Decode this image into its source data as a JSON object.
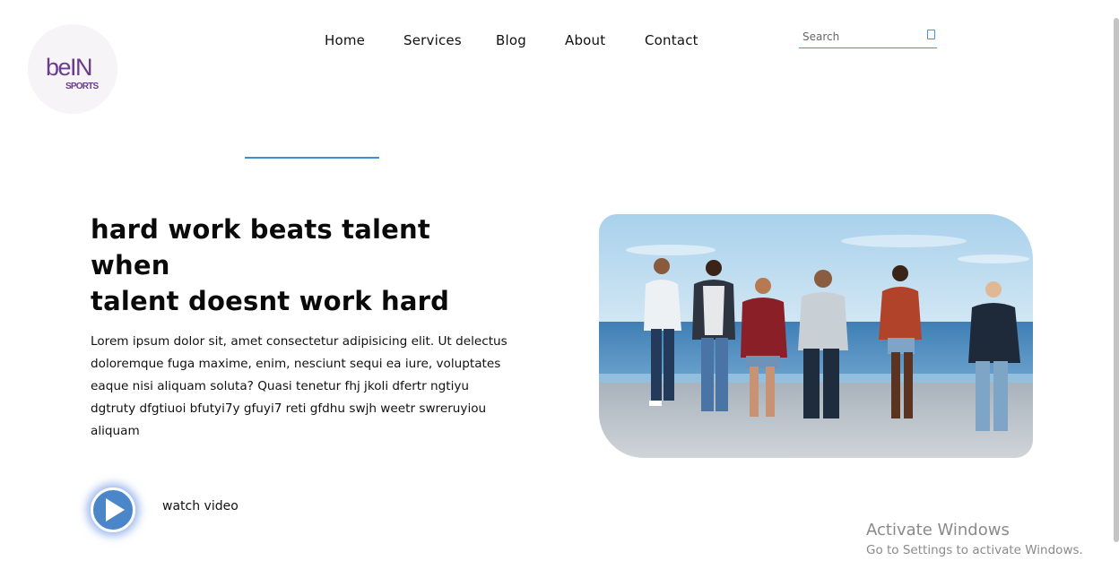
{
  "brand": {
    "logo_text_top": "beIN",
    "logo_text_bottom": "SPORTS",
    "logo_color": "#6b3b8e"
  },
  "nav": {
    "items": [
      {
        "label": "Home"
      },
      {
        "label": "Services"
      },
      {
        "label": "Blog"
      },
      {
        "label": "About"
      },
      {
        "label": "Contact"
      }
    ]
  },
  "search": {
    "placeholder": "Search",
    "value": "",
    "icon": "search-icon"
  },
  "hero": {
    "headline_line1": "hard work beats talent when",
    "headline_line2": "talent doesnt work hard",
    "body": "Lorem ipsum dolor sit, amet consectetur adipisicing elit. Ut delectus doloremque fuga maxime, enim, nesciunt sequi ea iure, voluptates eaque nisi aliquam soluta? Quasi tenetur fhj jkoli dfertr ngtiyu dgtruty dfgtiuoi bfutyi7y gfuyi7 reti gfdhu swjh weetr swreruyiou aliquam",
    "watch_label": "watch video",
    "play_icon": "play-icon"
  },
  "watermark": {
    "line1": "Activate Windows",
    "line2": "Go to Settings to activate Windows."
  },
  "colors": {
    "accent": "#3b8fd6",
    "play_button": "#4a86c8"
  }
}
